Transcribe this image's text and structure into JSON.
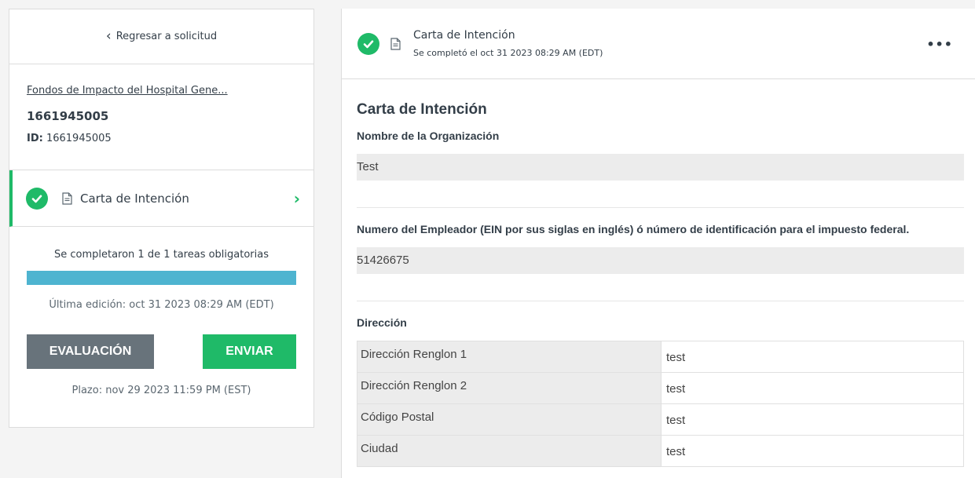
{
  "sidebar": {
    "back_label": "Regresar a solicitud",
    "app_link": "Fondos de Impacto del Hospital Gene...",
    "app_number": "1661945005",
    "id_label": "ID:",
    "id_value": "1661945005",
    "task": {
      "label": "Carta de Intención",
      "status": "completed"
    },
    "progress_text": "Se completaron 1 de 1 tareas obligatorias",
    "progress_fraction": 1.0,
    "last_edited": "Última edición: oct 31 2023 08:29 AM (EDT)",
    "eval_button": "EVALUACIÓN",
    "send_button": "ENVIAR",
    "deadline": "Plazo: nov 29 2023 11:59 PM (EST)"
  },
  "task_header": {
    "title": "Carta de Intención",
    "subtitle": "Se completó el oct 31 2023 08:29 AM (EDT)",
    "more_label": "•••"
  },
  "form": {
    "section_title": "Carta de Intención",
    "org_label": "Nombre de la Organización",
    "org_value": "Test",
    "ein_label": "Numero del Empleador (EIN por sus siglas en inglés) ó número de identificación para el impuesto federal.",
    "ein_value": "51426675",
    "address_label": "Dirección",
    "address_rows": [
      {
        "key": "Dirección Renglon 1",
        "value": "test"
      },
      {
        "key": "Dirección Renglon 2",
        "value": "test"
      },
      {
        "key": "Código Postal",
        "value": "test"
      },
      {
        "key": "Ciudad",
        "value": "test"
      }
    ]
  },
  "colors": {
    "success_green": "#1fba68",
    "progress_blue": "#4eb4d0",
    "eval_gray": "#68737b",
    "answer_bg": "#ececec"
  },
  "icons": {
    "check": "check-circle-icon",
    "doc": "document-icon",
    "back": "chevron-left-icon",
    "next": "chevron-right-icon",
    "more": "more-horizontal-icon"
  }
}
